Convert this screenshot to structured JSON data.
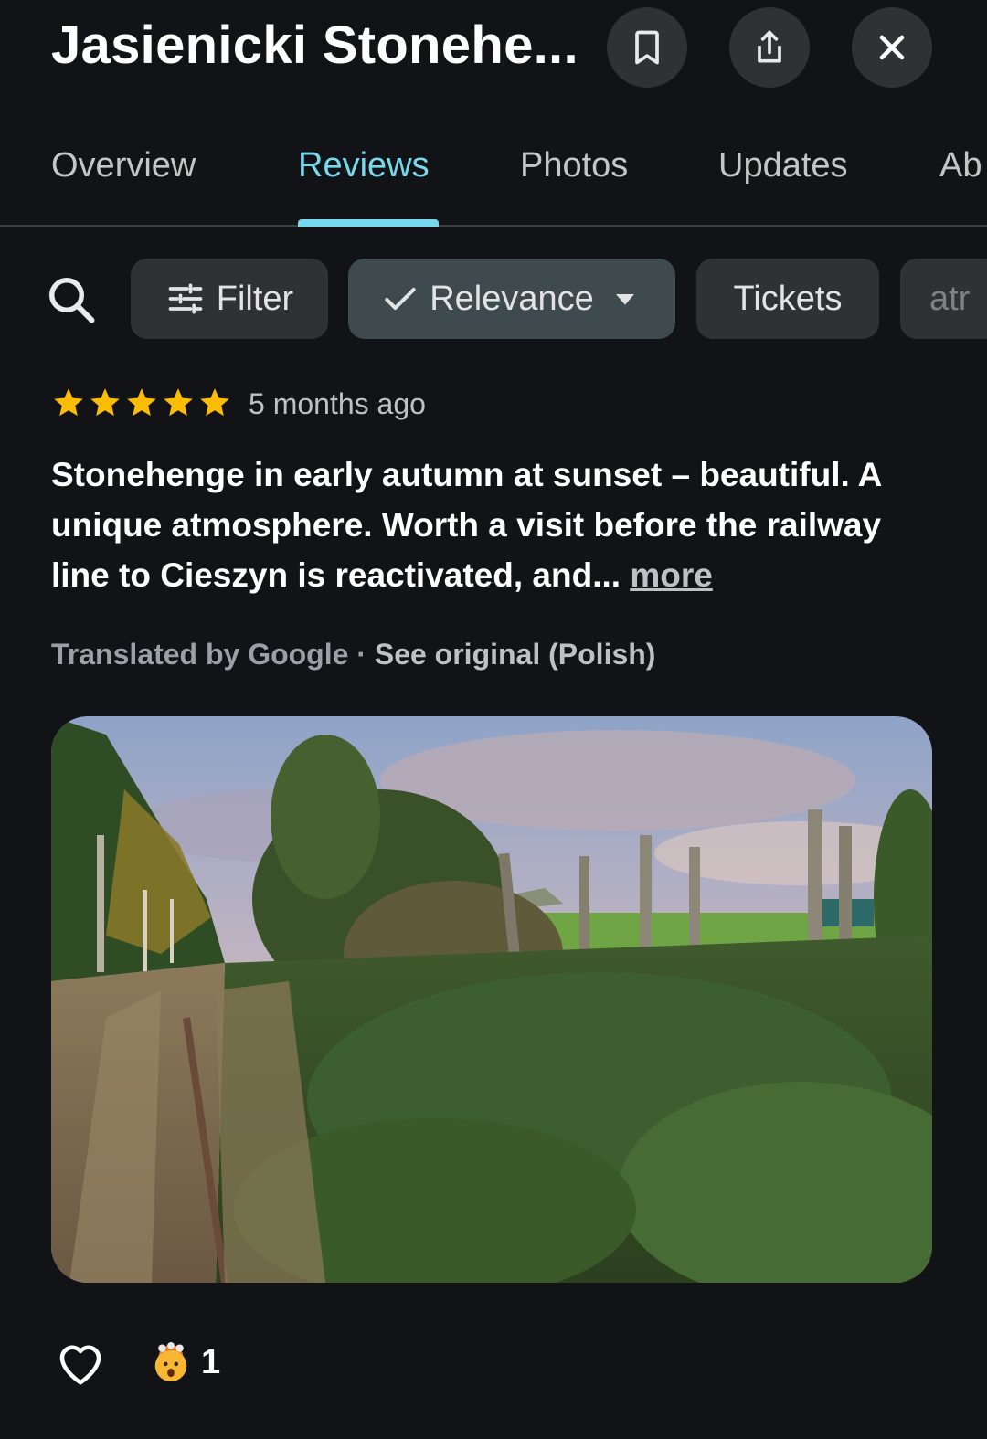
{
  "header": {
    "title": "Jasienicki Stonehe...",
    "save_icon": "bookmark-icon",
    "share_icon": "share-icon",
    "close_icon": "close-icon"
  },
  "tabs": [
    {
      "label": "Overview",
      "active": false
    },
    {
      "label": "Reviews",
      "active": true
    },
    {
      "label": "Photos",
      "active": false
    },
    {
      "label": "Updates",
      "active": false
    },
    {
      "label": "Ab",
      "active": false
    }
  ],
  "chips": {
    "filter": "Filter",
    "sort": "Relevance",
    "tickets": "Tickets",
    "partial": "atr"
  },
  "review": {
    "rating": 5,
    "time": "5 months ago",
    "text": "Stonehenge in early autumn at sunset – beautiful. A unique atmosphere. Worth a visit before the railway line to Cieszyn is reactivated, and... ",
    "more": "more",
    "translated_by": "Translated by Google · ",
    "see_original": "See original (Polish)",
    "reactions_count": "1"
  },
  "colors": {
    "background": "#121316",
    "accent": "#78d9ec",
    "star": "#fbbc04",
    "chip": "#303134"
  }
}
